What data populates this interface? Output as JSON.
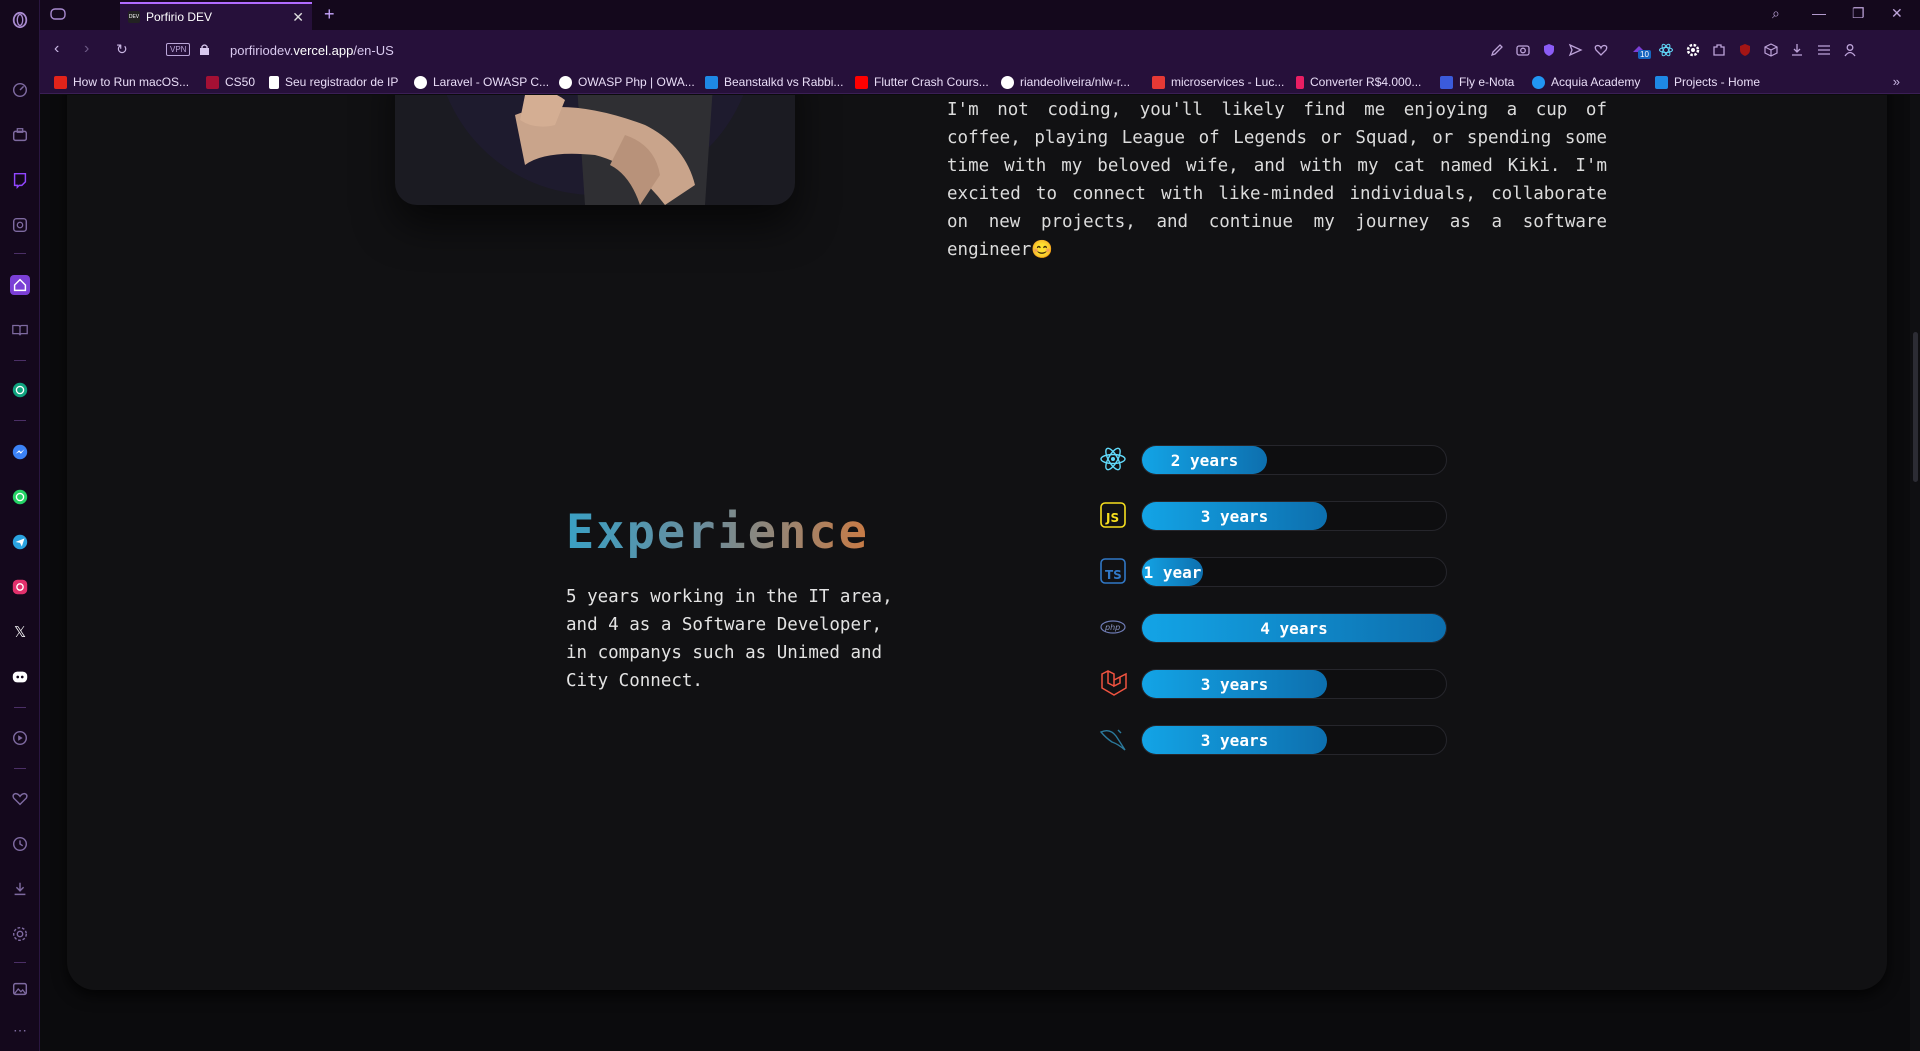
{
  "browser": {
    "tab_title": "Porfirio DEV",
    "tab_favicon_text": "DEV",
    "vpn_label": "VPN",
    "url_prefix": "porfiriodev.",
    "url_domain": "vercel.app",
    "url_path": "/en-US",
    "extension_badge": "10",
    "bookmarks": [
      {
        "label": "How to Run macOS...",
        "icon_color": "#e2231a"
      },
      {
        "label": "CS50",
        "icon_color": "#a41034"
      },
      {
        "label": "Seu registrador de IP",
        "icon_color": "#ffffff"
      },
      {
        "label": "Laravel - OWASP C...",
        "icon_color": "#ffffff"
      },
      {
        "label": "OWASP Php | OWA...",
        "icon_color": "#ffffff"
      },
      {
        "label": "Beanstalkd vs Rabbi...",
        "icon_color": "#1e88e5"
      },
      {
        "label": "Flutter Crash Cours...",
        "icon_color": "#ff0000"
      },
      {
        "label": "riandeoliveira/nlw-r...",
        "icon_color": "#ffffff"
      },
      {
        "label": "microservices - Luc...",
        "icon_color": "#e53935"
      },
      {
        "label": "Converter R$4.000...",
        "icon_color": "#e91e63"
      },
      {
        "label": "Fly e-Nota",
        "icon_color": "#3b5bdb"
      },
      {
        "label": "Acquia Academy",
        "icon_color": "#2196f3"
      },
      {
        "label": "Projects - Home",
        "icon_color": "#1e88e5"
      }
    ]
  },
  "about": {
    "text": "whether it's tackling complex coding issues or finding innovative solutions, I'm always up for the challenge. When I'm not coding, you'll likely find me enjoying a cup of coffee, playing League of Legends or Squad, or spending some time with my beloved wife, and with my cat named Kiki. I'm excited to connect with like-minded individuals, collaborate on new projects, and continue my journey as a software engineer😊"
  },
  "experience": {
    "title": "Experience",
    "description": "5 years working in the IT area, and 4 as a Software Developer, in companys such as Unimed and City Connect.",
    "skills": [
      {
        "icon": "react-icon",
        "label": "2 years",
        "fraction": 0.41
      },
      {
        "icon": "javascript-icon",
        "label": "3 years",
        "fraction": 0.61
      },
      {
        "icon": "typescript-icon",
        "label": "1 year",
        "fraction": 0.2
      },
      {
        "icon": "php-icon",
        "label": "4 years",
        "fraction": 1.0
      },
      {
        "icon": "laravel-icon",
        "label": "3 years",
        "fraction": 0.61
      },
      {
        "icon": "mysql-icon",
        "label": "3 years",
        "fraction": 0.61
      }
    ]
  }
}
